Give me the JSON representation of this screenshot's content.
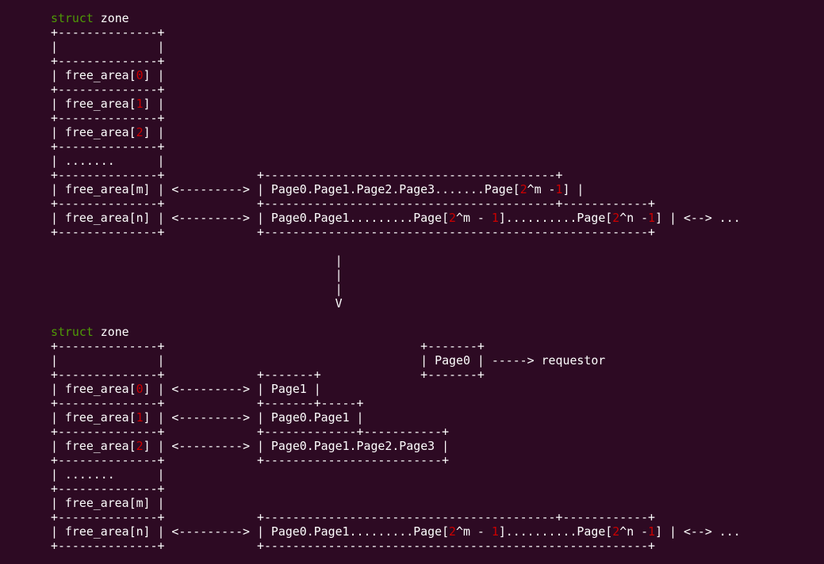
{
  "colors": {
    "background": "#2d0a23",
    "text": "#ffffff",
    "keyword": "#4e9a06",
    "number": "#cc0000"
  },
  "lines": [
    [
      {
        "t": "struct",
        "c": "kw"
      },
      {
        "t": " zone"
      }
    ],
    [
      {
        "t": "+--------------+"
      }
    ],
    [
      {
        "t": "|              |"
      }
    ],
    [
      {
        "t": "+--------------+"
      }
    ],
    [
      {
        "t": "| free_area["
      },
      {
        "t": "0",
        "c": "num"
      },
      {
        "t": "] |"
      }
    ],
    [
      {
        "t": "+--------------+"
      }
    ],
    [
      {
        "t": "| free_area["
      },
      {
        "t": "1",
        "c": "num"
      },
      {
        "t": "] |"
      }
    ],
    [
      {
        "t": "+--------------+"
      }
    ],
    [
      {
        "t": "| free_area["
      },
      {
        "t": "2",
        "c": "num"
      },
      {
        "t": "] |"
      }
    ],
    [
      {
        "t": "+--------------+"
      }
    ],
    [
      {
        "t": "| .......      |"
      }
    ],
    [
      {
        "t": "+--------------+             +-----------------------------------------+"
      }
    ],
    [
      {
        "t": "| free_area[m] | <---------> | Page0.Page1.Page2.Page3.......Page["
      },
      {
        "t": "2",
        "c": "num"
      },
      {
        "t": "^m -"
      },
      {
        "t": "1",
        "c": "num"
      },
      {
        "t": "] |"
      }
    ],
    [
      {
        "t": "+--------------+             +-----------------------------------------+------------+"
      }
    ],
    [
      {
        "t": "| free_area[n] | <---------> | Page0.Page1.........Page["
      },
      {
        "t": "2",
        "c": "num"
      },
      {
        "t": "^m - "
      },
      {
        "t": "1",
        "c": "num"
      },
      {
        "t": "]..........Page["
      },
      {
        "t": "2",
        "c": "num"
      },
      {
        "t": "^n -"
      },
      {
        "t": "1",
        "c": "num"
      },
      {
        "t": "] | <--> ..."
      }
    ],
    [
      {
        "t": "+--------------+             +------------------------------------------------------+"
      }
    ],
    [
      {
        "t": ""
      }
    ],
    [
      {
        "t": "                                        |"
      }
    ],
    [
      {
        "t": "                                        |"
      }
    ],
    [
      {
        "t": "                                        |"
      }
    ],
    [
      {
        "t": "                                        V"
      }
    ],
    [
      {
        "t": ""
      }
    ],
    [
      {
        "t": "struct",
        "c": "kw"
      },
      {
        "t": " zone"
      }
    ],
    [
      {
        "t": "+--------------+                                    +-------+"
      }
    ],
    [
      {
        "t": "|              |                                    | Page0 | -----> requestor"
      }
    ],
    [
      {
        "t": "+--------------+             +-------+              +-------+"
      }
    ],
    [
      {
        "t": "| free_area["
      },
      {
        "t": "0",
        "c": "num"
      },
      {
        "t": "] | <---------> | Page1 |"
      }
    ],
    [
      {
        "t": "+--------------+             +-------+-----+"
      }
    ],
    [
      {
        "t": "| free_area["
      },
      {
        "t": "1",
        "c": "num"
      },
      {
        "t": "] | <---------> | Page0.Page1 |"
      }
    ],
    [
      {
        "t": "+--------------+             +-------------+-----------+"
      }
    ],
    [
      {
        "t": "| free_area["
      },
      {
        "t": "2",
        "c": "num"
      },
      {
        "t": "] | <---------> | Page0.Page1.Page2.Page3 |"
      }
    ],
    [
      {
        "t": "+--------------+             +-------------------------+"
      }
    ],
    [
      {
        "t": "| .......      |"
      }
    ],
    [
      {
        "t": "+--------------+"
      }
    ],
    [
      {
        "t": "| free_area[m] |"
      }
    ],
    [
      {
        "t": "+--------------+             +-----------------------------------------+------------+"
      }
    ],
    [
      {
        "t": "| free_area[n] | <---------> | Page0.Page1.........Page["
      },
      {
        "t": "2",
        "c": "num"
      },
      {
        "t": "^m - "
      },
      {
        "t": "1",
        "c": "num"
      },
      {
        "t": "]..........Page["
      },
      {
        "t": "2",
        "c": "num"
      },
      {
        "t": "^n -"
      },
      {
        "t": "1",
        "c": "num"
      },
      {
        "t": "] | <--> ..."
      }
    ],
    [
      {
        "t": "+--------------+             +------------------------------------------------------+"
      }
    ]
  ]
}
